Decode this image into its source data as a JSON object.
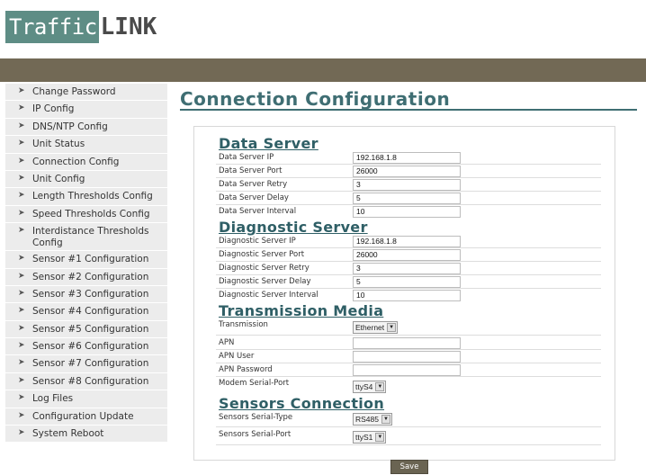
{
  "logo": {
    "part1": "Traffic",
    "part2": "LINK"
  },
  "sidebar": {
    "items": [
      {
        "label": "Change Password"
      },
      {
        "label": "IP Config"
      },
      {
        "label": "DNS/NTP Config"
      },
      {
        "label": "Unit Status"
      },
      {
        "label": "Connection Config"
      },
      {
        "label": "Unit Config"
      },
      {
        "label": "Length Thresholds Config"
      },
      {
        "label": "Speed Thresholds Config"
      },
      {
        "label": "Interdistance Thresholds Config"
      },
      {
        "label": "Sensor #1 Configuration"
      },
      {
        "label": "Sensor #2 Configuration"
      },
      {
        "label": "Sensor #3 Configuration"
      },
      {
        "label": "Sensor #4 Configuration"
      },
      {
        "label": "Sensor #5 Configuration"
      },
      {
        "label": "Sensor #6 Configuration"
      },
      {
        "label": "Sensor #7 Configuration"
      },
      {
        "label": "Sensor #8 Configuration"
      },
      {
        "label": "Log Files"
      },
      {
        "label": "Configuration Update"
      },
      {
        "label": "System Reboot"
      }
    ]
  },
  "page": {
    "title": "Connection Configuration"
  },
  "data_server": {
    "title": "Data Server",
    "rows": [
      {
        "label": "Data Server IP",
        "value": "192.168.1.8"
      },
      {
        "label": "Data Server Port",
        "value": "26000"
      },
      {
        "label": "Data Server Retry",
        "value": "3"
      },
      {
        "label": "Data Server Delay",
        "value": "5"
      },
      {
        "label": "Data Server Interval",
        "value": "10"
      }
    ]
  },
  "diagnostic_server": {
    "title": "Diagnostic Server",
    "rows": [
      {
        "label": "Diagnostic Server IP",
        "value": "192.168.1.8"
      },
      {
        "label": "Diagnostic Server Port",
        "value": "26000"
      },
      {
        "label": "Diagnostic Server Retry",
        "value": "3"
      },
      {
        "label": "Diagnostic Server Delay",
        "value": "5"
      },
      {
        "label": "Diagnostic Server Interval",
        "value": "10"
      }
    ]
  },
  "transmission_media": {
    "title": "Transmission Media",
    "transmission": {
      "label": "Transmission",
      "value": "Ethernet"
    },
    "apn": {
      "label": "APN",
      "value": ""
    },
    "apn_user": {
      "label": "APN User",
      "value": ""
    },
    "apn_password": {
      "label": "APN Password",
      "value": ""
    },
    "modem_port": {
      "label": "Modem Serial-Port",
      "value": "ttyS4"
    }
  },
  "sensors_connection": {
    "title": "Sensors Connection",
    "serial_type": {
      "label": "Sensors Serial-Type",
      "value": "RS485"
    },
    "serial_port": {
      "label": "Sensors Serial-Port",
      "value": "ttyS1"
    }
  },
  "actions": {
    "save_label": "Save"
  },
  "colors": {
    "header_bar": "#726955",
    "title": "#3f6e73",
    "logo_bg": "#5e8d85",
    "sidebar_bg": "#ececec"
  }
}
